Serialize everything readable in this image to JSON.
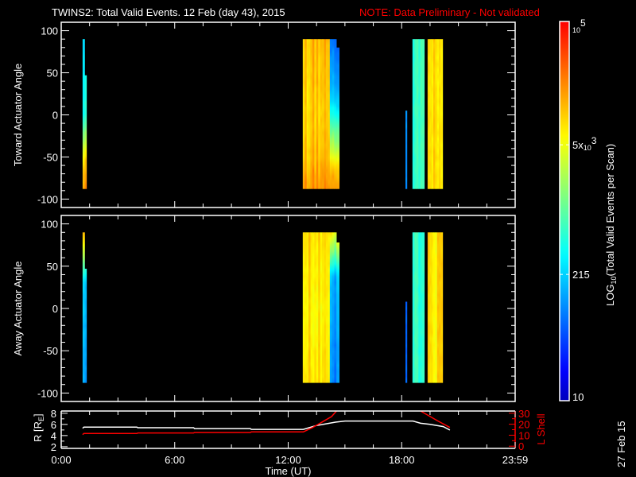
{
  "chart_data": [
    {
      "type": "heatmap",
      "title": "TWINS2: Total Valid Events. 12 Feb (day  43), 2015",
      "note": "NOTE: Data Preliminary - Not validated",
      "ylabel": "Toward Actuator Angle",
      "ylim": [
        -110,
        110
      ],
      "yticks": [
        "100",
        "50",
        "0",
        "-50",
        "-100"
      ],
      "ytick_values": [
        100,
        50,
        0,
        -50,
        -100
      ],
      "xlim_hours": [
        0,
        24
      ],
      "z_units": "log10 events",
      "segments": [
        {
          "t": [
            1.13,
            1.24
          ],
          "angle": [
            -88,
            90
          ],
          "profile": [
            [
              90,
              2.4
            ],
            [
              0,
              2.6
            ],
            [
              -30,
              3.3
            ],
            [
              -55,
              3.9
            ],
            [
              -88,
              4.2
            ]
          ]
        },
        {
          "t": [
            1.24,
            1.34
          ],
          "angle": [
            -88,
            47
          ],
          "profile": [
            [
              47,
              2.5
            ],
            [
              0,
              2.6
            ],
            [
              -30,
              3.3
            ],
            [
              -55,
              3.9
            ],
            [
              -88,
              4.2
            ]
          ]
        },
        {
          "t": [
            12.77,
            14.2
          ],
          "angle": [
            -88,
            90
          ],
          "profile": [
            [
              90,
              4.1
            ],
            [
              0,
              4.0
            ],
            [
              -50,
              4.1
            ],
            [
              -88,
              4.3
            ]
          ]
        },
        {
          "t": [
            14.2,
            14.55
          ],
          "angle": [
            -88,
            90
          ],
          "profile": [
            [
              90,
              1.9
            ],
            [
              20,
              2.3
            ],
            [
              -15,
              3.0
            ],
            [
              -45,
              3.6
            ],
            [
              -65,
              4.1
            ],
            [
              -88,
              4.3
            ]
          ]
        },
        {
          "t": [
            14.55,
            14.7
          ],
          "angle": [
            -88,
            80
          ],
          "profile": [
            [
              80,
              1.9
            ],
            [
              20,
              2.3
            ],
            [
              -15,
              3.0
            ],
            [
              -45,
              3.6
            ],
            [
              -65,
              4.1
            ],
            [
              -88,
              4.3
            ]
          ]
        },
        {
          "t": [
            18.2,
            18.28
          ],
          "angle": [
            -88,
            5
          ],
          "profile": [
            [
              5,
              1.9
            ],
            [
              -88,
              1.9
            ]
          ]
        },
        {
          "t": [
            18.57,
            19.2
          ],
          "angle": [
            -88,
            90
          ],
          "profile": [
            [
              90,
              2.8
            ],
            [
              -88,
              2.8
            ]
          ]
        },
        {
          "t": [
            19.37,
            20.17
          ],
          "angle": [
            -88,
            90
          ],
          "profile": [
            [
              90,
              4.0
            ],
            [
              -88,
              4.0
            ]
          ]
        }
      ]
    },
    {
      "type": "heatmap",
      "ylabel": "Away Actuator Angle",
      "ylim": [
        -110,
        110
      ],
      "yticks": [
        "100",
        "50",
        "0",
        "-50",
        "-100"
      ],
      "ytick_values": [
        100,
        50,
        0,
        -50,
        -100
      ],
      "xlim_hours": [
        0,
        24
      ],
      "segments": [
        {
          "t": [
            1.13,
            1.24
          ],
          "angle": [
            -88,
            90
          ],
          "profile": [
            [
              90,
              4.0
            ],
            [
              70,
              3.5
            ],
            [
              50,
              2.8
            ],
            [
              30,
              2.2
            ],
            [
              -88,
              2.0
            ]
          ]
        },
        {
          "t": [
            1.24,
            1.34
          ],
          "angle": [
            -88,
            47
          ],
          "profile": [
            [
              47,
              2.7
            ],
            [
              30,
              2.2
            ],
            [
              -88,
              2.0
            ]
          ]
        },
        {
          "t": [
            12.77,
            14.2
          ],
          "angle": [
            -88,
            90
          ],
          "profile": [
            [
              90,
              4.0
            ],
            [
              0,
              3.9
            ],
            [
              -88,
              4.0
            ]
          ]
        },
        {
          "t": [
            14.2,
            14.55
          ],
          "angle": [
            -88,
            90
          ],
          "profile": [
            [
              90,
              3.8
            ],
            [
              70,
              3.3
            ],
            [
              55,
              2.8
            ],
            [
              35,
              2.2
            ],
            [
              -88,
              2.0
            ]
          ]
        },
        {
          "t": [
            14.55,
            14.7
          ],
          "angle": [
            -88,
            78
          ],
          "profile": [
            [
              78,
              3.6
            ],
            [
              55,
              2.8
            ],
            [
              35,
              2.2
            ],
            [
              -88,
              2.0
            ]
          ]
        },
        {
          "t": [
            18.2,
            18.28
          ],
          "angle": [
            -88,
            8
          ],
          "profile": [
            [
              8,
              1.7
            ],
            [
              -88,
              1.7
            ]
          ]
        },
        {
          "t": [
            18.57,
            19.2
          ],
          "angle": [
            -88,
            90
          ],
          "profile": [
            [
              90,
              2.8
            ],
            [
              -88,
              2.8
            ]
          ]
        },
        {
          "t": [
            19.37,
            20.17
          ],
          "angle": [
            -88,
            90
          ],
          "profile": [
            [
              90,
              3.9
            ],
            [
              -88,
              3.9
            ]
          ]
        }
      ]
    },
    {
      "type": "line",
      "xlabel": "Time (UT)",
      "xticks": [
        "0:00",
        "6:00",
        "12:00",
        "18:00",
        "23:59"
      ],
      "xtick_hours": [
        0,
        6,
        12,
        18,
        24
      ],
      "ylabel_left": "R [R",
      "ylabel_left_sub": "E",
      "ylabel_left_end": "]",
      "ylim_left": [
        1.7,
        8.4
      ],
      "yticks_left": [
        "8",
        "6",
        "4",
        "2"
      ],
      "ytick_left_values": [
        8,
        6,
        4,
        2
      ],
      "ylabel_right": "L Shell",
      "ylim_right": [
        -2,
        32
      ],
      "yticks_right": [
        "30",
        "20",
        "10",
        "0"
      ],
      "ytick_right_values": [
        30,
        20,
        10,
        0
      ],
      "series": [
        {
          "name": "R",
          "color": "#ffffff",
          "axis": "left",
          "x": [
            1.13,
            1.2,
            4.0,
            4.05,
            7.0,
            7.05,
            10.0,
            10.05,
            12.8,
            13.1,
            13.5,
            14.0,
            14.5,
            15.0,
            18.6,
            19.0,
            19.5,
            20.2,
            20.55
          ],
          "y": [
            5.3,
            5.5,
            5.5,
            5.4,
            5.4,
            5.25,
            5.25,
            5.1,
            5.1,
            5.4,
            5.8,
            6.1,
            6.4,
            6.6,
            6.6,
            6.2,
            6.0,
            5.6,
            5.0
          ]
        },
        {
          "name": "L Shell",
          "color": "#ff0000",
          "axis": "right",
          "x": [
            1.13,
            1.2,
            4.0,
            4.05,
            7.0,
            7.05,
            10.0,
            10.05,
            12.8,
            13.3,
            13.8,
            14.3,
            14.55
          ],
          "y": [
            10.5,
            11.5,
            11.5,
            12.0,
            12.0,
            12.5,
            12.5,
            13.0,
            13.0,
            17.0,
            22.0,
            27.0,
            32.0
          ]
        },
        {
          "name": "L Shell (2)",
          "color": "#ff0000",
          "axis": "right",
          "x": [
            19.0,
            19.4,
            19.9,
            20.55
          ],
          "y": [
            32.0,
            28.0,
            23.0,
            17.0
          ]
        }
      ]
    }
  ],
  "colorbar": {
    "label_prefix": "LOG",
    "label_sub": "10",
    "label_rest": "(Total Valid Events per Scan)",
    "range_log10": [
      1,
      5
    ],
    "ticks": [
      {
        "value": 5,
        "base": "10",
        "exp": "5",
        "prefix": ""
      },
      {
        "value": 3.699,
        "base": "10",
        "exp": "3",
        "prefix": "5x"
      },
      {
        "value": 2.332,
        "text": "215"
      },
      {
        "value": 1,
        "text": "10"
      }
    ]
  },
  "date_stamp": "27 Feb 15",
  "colors": {
    "note": "#ff0000",
    "lshell": "#ff0000",
    "axes": "#ffffff",
    "background": "#000000"
  }
}
